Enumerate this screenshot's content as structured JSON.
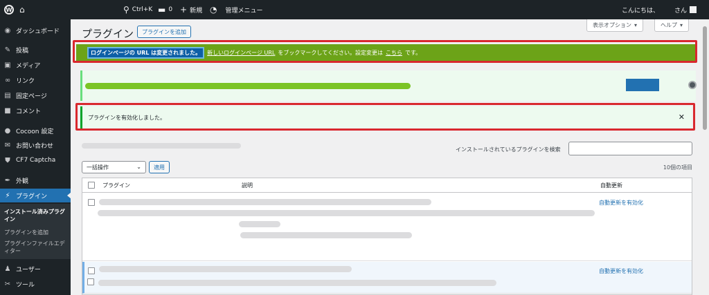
{
  "adminbar": {
    "search_shortcut": "Ctrl+K",
    "comments_count": "0",
    "new_label": "新規",
    "manage_menu": "管理メニュー",
    "greeting": "こんにちは、",
    "greeting_suffix": "さん"
  },
  "sidebar": {
    "items": [
      {
        "label": "ダッシュボード",
        "icon": "dashboard-icon"
      },
      {
        "label": "投稿",
        "icon": "pin-icon"
      },
      {
        "label": "メディア",
        "icon": "media-icon"
      },
      {
        "label": "リンク",
        "icon": "link-icon"
      },
      {
        "label": "固定ページ",
        "icon": "page-icon"
      },
      {
        "label": "コメント",
        "icon": "comment-icon"
      },
      {
        "label": "Cocoon 設定",
        "icon": "cocoon-icon"
      },
      {
        "label": "お問い合わせ",
        "icon": "mail-icon"
      },
      {
        "label": "CF7 Captcha",
        "icon": "shield-icon"
      },
      {
        "label": "外観",
        "icon": "brush-icon"
      },
      {
        "label": "プラグイン",
        "icon": "plugin-icon"
      },
      {
        "label": "ユーザー",
        "icon": "user-icon"
      },
      {
        "label": "ツール",
        "icon": "wrench-icon"
      }
    ],
    "submenu": [
      "インストール済みプラグイン",
      "プラグインを追加",
      "プラグインファイルエディター"
    ]
  },
  "main": {
    "title": "プラグイン",
    "add_button": "プラグインを追加",
    "screen_options": "表示オプション",
    "help": "ヘルプ",
    "notice_login": {
      "highlight": "ログインページの URL は変更されました。",
      "link1": "新しいログインページ URL",
      "middle": "をブックマークしてください。設定変更は",
      "link2": "こちら",
      "end": "です。"
    },
    "notice_activated": "プラグインを有効化しました。",
    "search_label": "インストールされているプラグインを検索",
    "bulk_action": "一括操作",
    "apply": "適用",
    "item_count": "10個の項目",
    "columns": {
      "plugin": "プラグイン",
      "description": "説明",
      "auto_update": "自動更新"
    },
    "auto_update_link": "自動更新を有効化"
  },
  "colors": {
    "admin_dark": "#1d2327",
    "accent_blue": "#2271b1",
    "notice_green": "#6ca318",
    "highlight_red": "#d9272e"
  }
}
